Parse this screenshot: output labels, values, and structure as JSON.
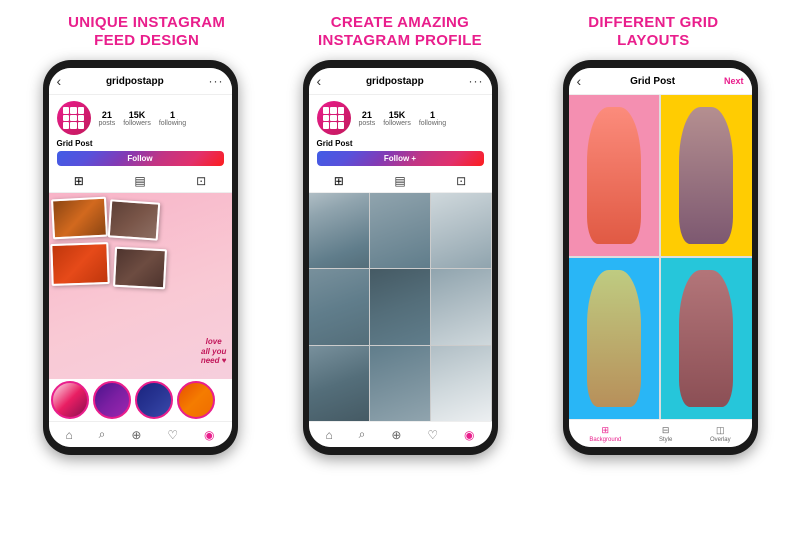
{
  "section1": {
    "title_line1": "UNIQUE INSTAGRAM",
    "title_line2": "FEED DESIGN"
  },
  "section2": {
    "title_line1": "CREATE AMAZING",
    "title_line2": "INSTAGRAM PROFILE"
  },
  "section3": {
    "title_line1": "DIFFERENT GRID",
    "title_line2": "LAYOUTS"
  },
  "phone1": {
    "header_name": "gridpostapp",
    "stats": [
      {
        "num": "21",
        "label": "posts"
      },
      {
        "num": "15K",
        "label": "followers"
      },
      {
        "num": "1",
        "label": "following"
      }
    ],
    "username": "Grid Post",
    "follow_label": "Follow",
    "collage_text": "love\nall you\nneed"
  },
  "phone2": {
    "header_name": "gridpostapp",
    "stats": [
      {
        "num": "21",
        "label": "posts"
      },
      {
        "num": "15K",
        "label": "followers"
      },
      {
        "num": "1",
        "label": "following"
      }
    ],
    "username": "Grid Post",
    "follow_label": "Follow +"
  },
  "phone3": {
    "header_name": "Grid Post",
    "next_label": "Next",
    "toolbar_items": [
      {
        "label": "Background"
      },
      {
        "label": "Style"
      },
      {
        "label": "Overlay"
      }
    ]
  },
  "colors": {
    "accent": "#e91e8c",
    "dark": "#1a1a1a"
  }
}
